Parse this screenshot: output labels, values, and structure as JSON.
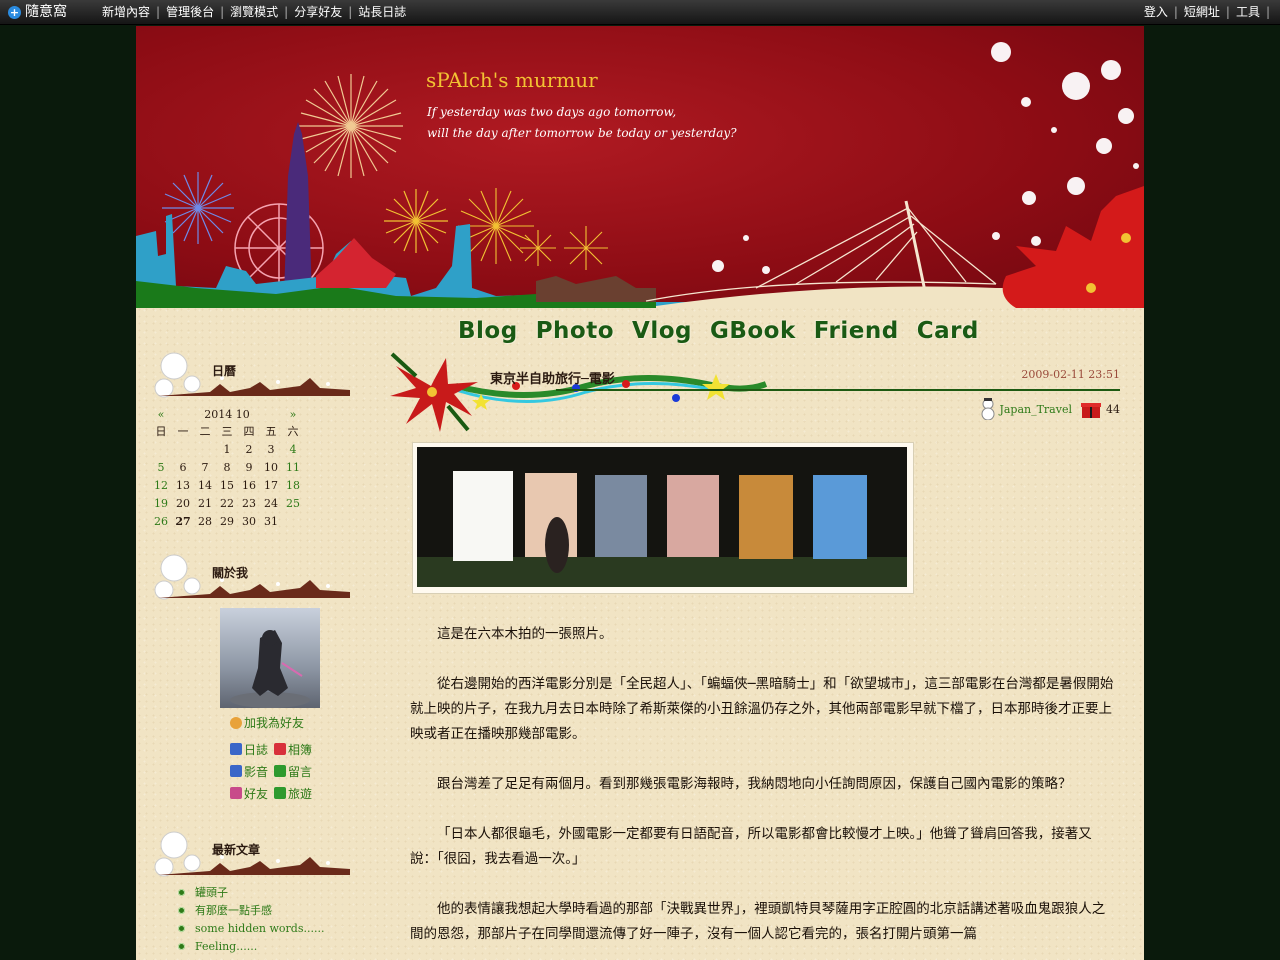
{
  "topbar": {
    "brand": "隨意窩",
    "menu": [
      "新增內容",
      "管理後台",
      "瀏覽模式",
      "分享好友",
      "站長日誌"
    ],
    "right": [
      "登入",
      "短網址",
      "工具"
    ]
  },
  "header": {
    "title": "sPAlch's murmur",
    "subtitle_line1": "If yesterday was two days ago tomorrow,",
    "subtitle_line2": "will the day after tomorrow be today or yesterday?"
  },
  "nav": [
    "Blog",
    "Photo",
    "Vlog",
    "GBook",
    "Friend",
    "Card"
  ],
  "sidebar": {
    "calendar": {
      "title": "日曆",
      "prev": "«",
      "month": "2014 10",
      "next": "»",
      "weekdays": [
        "日",
        "一",
        "二",
        "三",
        "四",
        "五",
        "六"
      ],
      "weeks": [
        [
          "",
          "",
          "",
          "1",
          "2",
          "3",
          "4"
        ],
        [
          "5",
          "6",
          "7",
          "8",
          "9",
          "10",
          "11"
        ],
        [
          "12",
          "13",
          "14",
          "15",
          "16",
          "17",
          "18"
        ],
        [
          "19",
          "20",
          "21",
          "22",
          "23",
          "24",
          "25"
        ],
        [
          "26",
          "27",
          "28",
          "29",
          "30",
          "31",
          ""
        ]
      ],
      "today": "27"
    },
    "about": {
      "title": "關於我",
      "add_friend": "加我為好友",
      "links": [
        {
          "label": "日誌",
          "icon": "diary-icon",
          "color": "#3a66c8"
        },
        {
          "label": "相簿",
          "icon": "album-icon",
          "color": "#d8303a"
        },
        {
          "label": "影音",
          "icon": "video-icon",
          "color": "#3a66c8"
        },
        {
          "label": "留言",
          "icon": "guestbook-icon",
          "color": "#2e9a2e"
        },
        {
          "label": "好友",
          "icon": "friend-icon",
          "color": "#c84a8a"
        },
        {
          "label": "旅遊",
          "icon": "travel-icon",
          "color": "#2e9a2e"
        }
      ]
    },
    "recent": {
      "title": "最新文章",
      "items": [
        "罐頭子",
        "有那麼一點手感",
        "some hidden words......",
        "Feeling......"
      ]
    }
  },
  "post": {
    "title": "東京半自助旅行─電影",
    "date": "2009-02-11 23:51",
    "category": "Japan_Travel",
    "count": "44",
    "paragraphs": [
      "這是在六本木拍的一張照片。",
      "從右邊開始的西洋電影分別是「全民超人」、「蝙蝠俠─黑暗騎士」和「欲望城市」，這三部電影在台灣都是暑假開始就上映的片子，在我九月去日本時除了希斯萊傑的小丑餘溫仍存之外，其他兩部電影早就下檔了，日本那時後才正要上映或者正在播映那幾部電影。",
      "跟台灣差了足足有兩個月。看到那幾張電影海報時，我納悶地向小任詢問原因，保護自己國內電影的策略？",
      "「日本人都很龜毛，外國電影一定都要有日語配音，所以電影都會比較慢才上映。」他聳了聳肩回答我，接著又說：「很囧，我去看過一次。」",
      "他的表情讓我想起大學時看過的那部「決戰異世界」，裡頭凱特貝琴薩用字正腔圓的北京話講述著吸血鬼跟狼人之間的恩怨，那部片子在同學間還流傳了好一陣子，沒有一個人認它看完的，張名打開片頭第一篇"
    ]
  }
}
